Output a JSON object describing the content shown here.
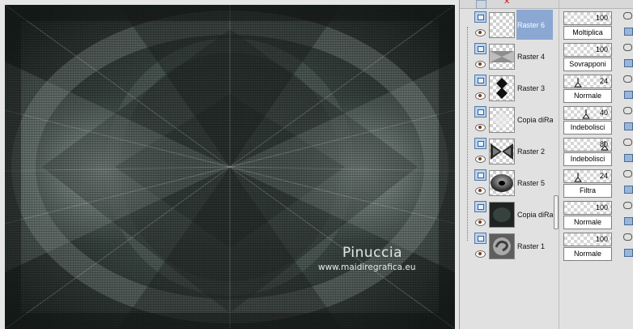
{
  "canvas": {
    "watermark_name": "Pinuccia",
    "watermark_url": "www.maidiregrafica.eu"
  },
  "layers": [
    {
      "name": "Raster 6",
      "opacity": "100",
      "blend_mode": "Moltiplica",
      "selected": true,
      "thumb": "checker"
    },
    {
      "name": "Raster 4",
      "opacity": "100",
      "blend_mode": "Sovrapponi",
      "selected": false,
      "thumb": "grey-band"
    },
    {
      "name": "Raster 3",
      "opacity": "24",
      "blend_mode": "Normale",
      "selected": false,
      "thumb": "black-diamonds"
    },
    {
      "name": "Copia diRa",
      "opacity": "40",
      "blend_mode": "Indebolisci",
      "selected": false,
      "thumb": "faint"
    },
    {
      "name": "Raster 2",
      "opacity": "80",
      "blend_mode": "Indebolisci",
      "selected": false,
      "thumb": "bowtie"
    },
    {
      "name": "Raster 5",
      "opacity": "24",
      "blend_mode": "Filtra",
      "selected": false,
      "thumb": "orb"
    },
    {
      "name": "Copia diRa",
      "opacity": "100",
      "blend_mode": "Normale",
      "selected": false,
      "thumb": "dark"
    },
    {
      "name": "Raster 1",
      "opacity": "100",
      "blend_mode": "Normale",
      "selected": false,
      "thumb": "swirl"
    }
  ]
}
